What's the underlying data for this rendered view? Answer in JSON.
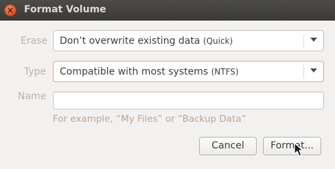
{
  "window": {
    "title": "Format Volume",
    "close_glyph": "×"
  },
  "erase": {
    "label": "Erase",
    "value_main": "Don’t overwrite existing data",
    "value_detail": "(Quick)"
  },
  "type": {
    "label": "Type",
    "value_main": "Compatible with most systems",
    "value_detail": "(NTFS)"
  },
  "name": {
    "label": "Name",
    "value": "",
    "hint": "For example, “My Files” or “Backup Data”"
  },
  "buttons": {
    "cancel_label": "Cancel",
    "format_label": "Format..."
  },
  "colors": {
    "accent_focus": "#e3a484",
    "hint": "#c1a592",
    "close": "#e2582c"
  }
}
